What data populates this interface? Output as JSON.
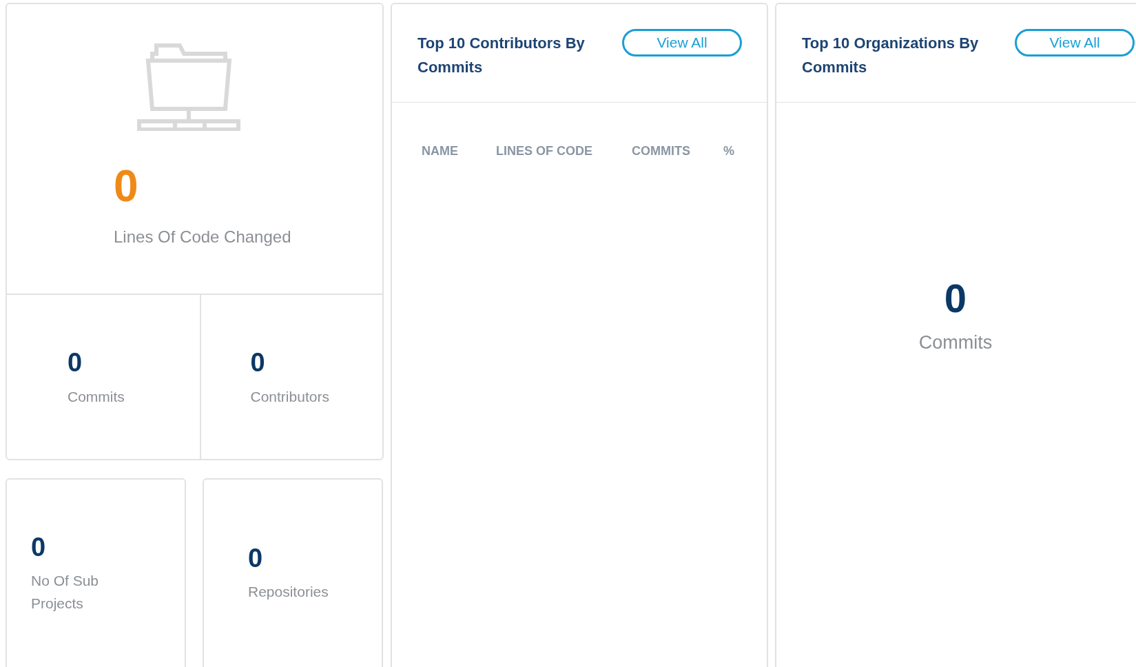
{
  "summary": {
    "value": "0",
    "label": "Lines Of Code Changed"
  },
  "stats": [
    {
      "value": "0",
      "label": "Commits"
    },
    {
      "value": "0",
      "label": "Contributors"
    }
  ],
  "small_cards": [
    {
      "value": "0",
      "label": "No Of Sub Projects"
    },
    {
      "value": "0",
      "label": "Repositories"
    }
  ],
  "contributors_panel": {
    "title": "Top 10 Contributors By Commits",
    "button": "View All",
    "columns": [
      "NAME",
      "LINES OF CODE",
      "COMMITS",
      "%"
    ]
  },
  "organizations_panel": {
    "title": "Top 10 Organizations By Commits",
    "button": "View All",
    "value": "0",
    "label": "Commits"
  }
}
